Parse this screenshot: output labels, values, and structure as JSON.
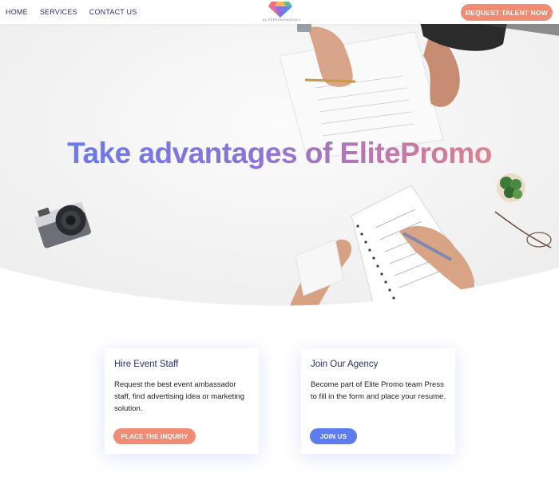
{
  "nav": {
    "links": [
      "HOME",
      "SERVICES",
      "CONTACT US"
    ],
    "logo_text": "ELITEPROMOAGENCY",
    "cta_label": "REQUEST TALENT NOW"
  },
  "hero": {
    "title": "Take advantages of ElitePromo"
  },
  "cards": [
    {
      "title": "Hire Event Staff",
      "text": "Request the best event ambassador staff, find advertising idea or marketing solution.",
      "button": "PLACE THE INQUIRY"
    },
    {
      "title": "Join Our Agency",
      "text": "Become part of Elite Promo team Press to fill in the form and place your resume.",
      "button": "JOIN US"
    }
  ],
  "colors": {
    "accent_orange": "#f08b74",
    "accent_blue": "#5d7cf0",
    "nav_text": "#2c2f6b"
  }
}
